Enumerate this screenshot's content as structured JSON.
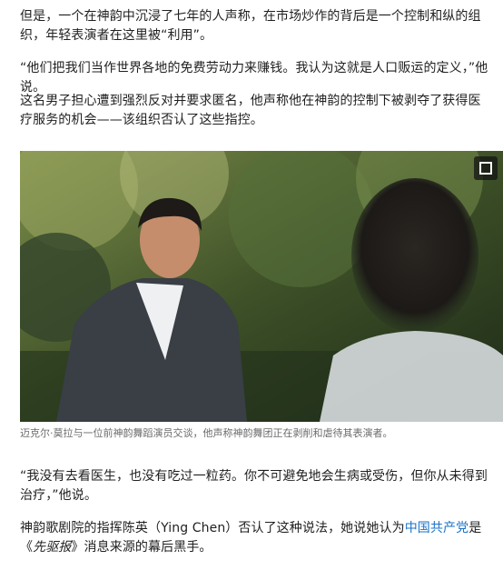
{
  "article": {
    "paragraphs": {
      "p1": "但是，一个在神韵中沉浸了七年的人声称，在市场炒作的背后是一个控制和纵的组织，年轻表演者在这里被“利用”。",
      "p2": "“他们把我们当作世界各地的免费劳动力来赚钱。我认为这就是人口贩运的定义，”他说。",
      "p3": "这名男子担心遭到强烈反对并要求匿名，他声称他在神韵的控制下被剥夺了获得医疗服务的机会——该组织否认了这些指控。",
      "p4": "“我没有去看医生，也没有吃过一粒药。你不可避免地会生病或受伤，但你从未得到治疗，”他说。",
      "p5": {
        "before": "神韵歌剧院的指挥陈英（Ying Chen）否认了这种说法，她说她认为",
        "link": "中国共产党",
        "middle": "是《",
        "italic": "先驱报",
        "after": "》消息来源的幕后黑手。"
      }
    },
    "media": {
      "caption": "迈克尔·莫拉与一位前神韵舞蹈演员交谈，他声称神韵舞团正在剥削和虐待其表演者。",
      "fullscreen_icon": "fullscreen-icon"
    },
    "colors": {
      "text": "#1f1f1f",
      "link": "#1a73c8",
      "caption": "#6b6b6b"
    }
  }
}
